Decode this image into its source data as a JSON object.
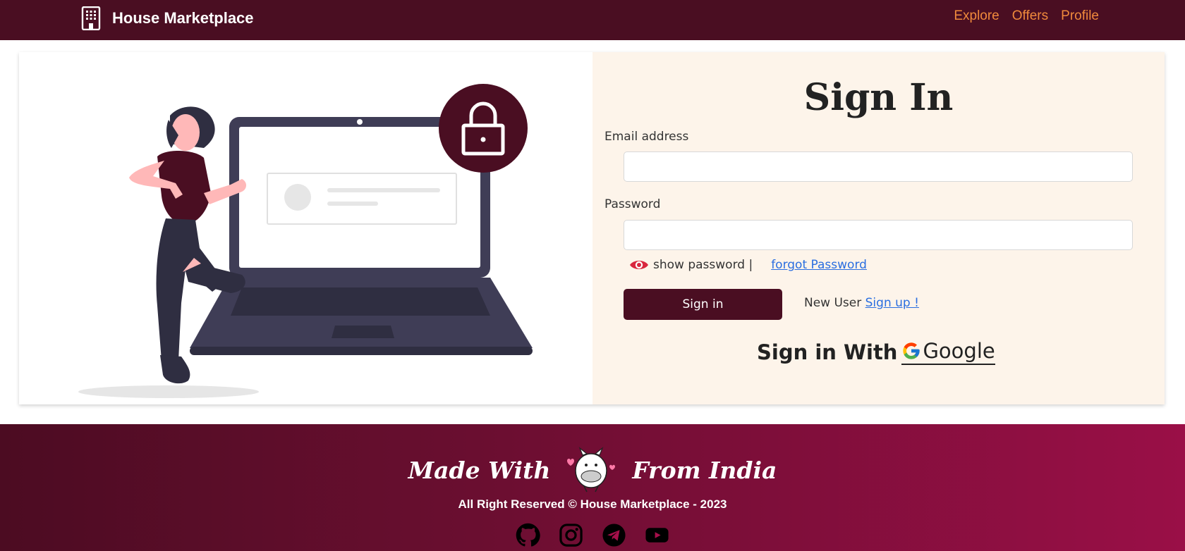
{
  "navbar": {
    "brand_title": "House Marketplace",
    "links": [
      {
        "label": "Explore"
      },
      {
        "label": "Offers"
      },
      {
        "label": "Profile"
      }
    ]
  },
  "signin": {
    "title": "Sign In",
    "email_label": "Email address",
    "email_value": "",
    "password_label": "Password",
    "password_value": "",
    "show_password_label": "show password |",
    "forgot_label": "forgot Password",
    "button_label": "Sign in",
    "new_user_label": "New User",
    "signup_label": "Sign up !",
    "google_prefix": "Sign in With",
    "google_label": "Google"
  },
  "footer": {
    "made_with": "Made With",
    "from_india": "From India",
    "copyright": "All Right Reserved © House Marketplace - 2023",
    "socials": [
      "github-icon",
      "instagram-icon",
      "telegram-icon",
      "youtube-icon"
    ]
  },
  "colors": {
    "primary": "#4a0e22",
    "nav_link": "#f08a3c",
    "link": "#2a6ee0",
    "panel_bg": "#fdf4ea"
  }
}
